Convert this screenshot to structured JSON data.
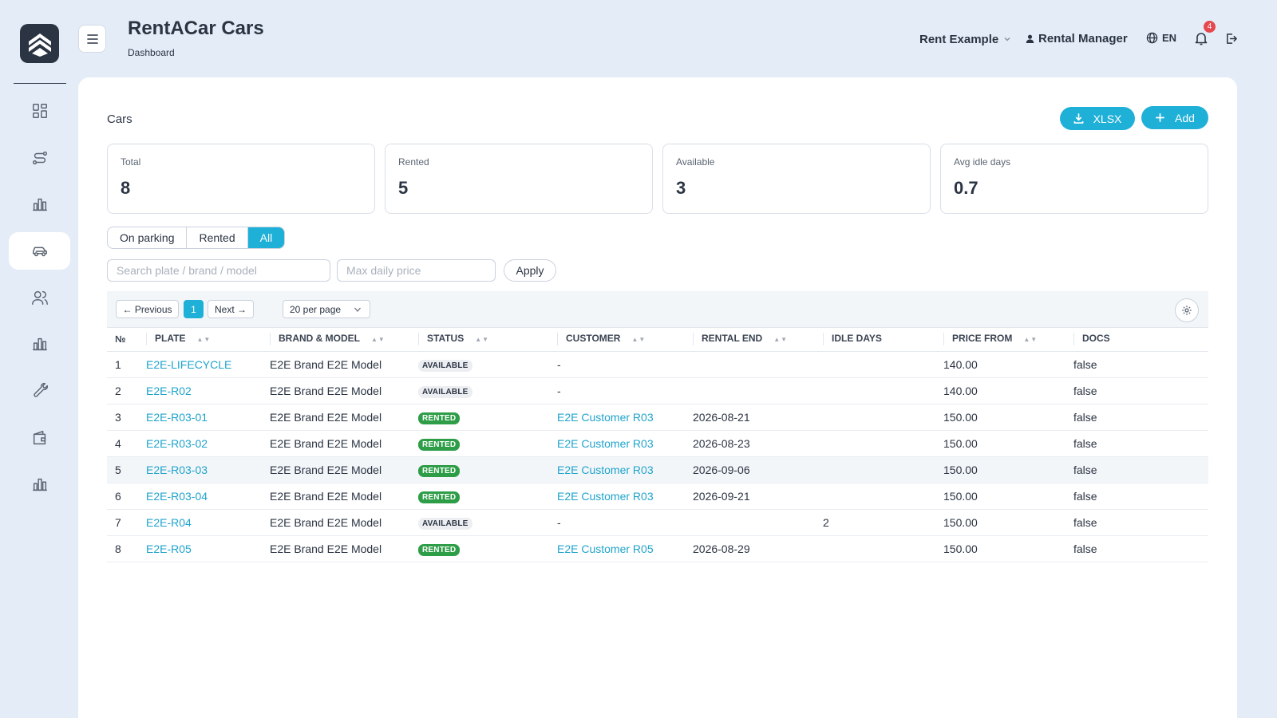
{
  "header": {
    "title": "RentACar Cars",
    "breadcrumb": "Dashboard",
    "tenant": "Rent Example",
    "user": "Rental Manager",
    "language": "EN",
    "notification_count": "4"
  },
  "sidebar": {
    "items": [
      {
        "icon": "dashboard-icon"
      },
      {
        "icon": "routes-icon"
      },
      {
        "icon": "chart-icon"
      },
      {
        "icon": "car-icon",
        "active": true
      },
      {
        "icon": "users-icon"
      },
      {
        "icon": "chart-icon"
      },
      {
        "icon": "wrench-icon"
      },
      {
        "icon": "wallet-icon"
      },
      {
        "icon": "chart-icon"
      }
    ]
  },
  "page": {
    "section_title": "Cars",
    "xlsx_label": "XLSX",
    "add_label": "Add"
  },
  "stats": [
    {
      "label": "Total",
      "value": "8"
    },
    {
      "label": "Rented",
      "value": "5"
    },
    {
      "label": "Available",
      "value": "3"
    },
    {
      "label": "Avg idle days",
      "value": "0.7"
    }
  ],
  "filters": {
    "segments": [
      "On parking",
      "Rented",
      "All"
    ],
    "active_segment": "All",
    "search_placeholder": "Search plate / brand / model",
    "price_placeholder": "Max daily price",
    "apply_label": "Apply"
  },
  "pagination": {
    "previous": "← Previous",
    "current": "1",
    "next": "Next →",
    "per_page": "20 per page"
  },
  "table": {
    "columns": [
      "№",
      "Plate",
      "Brand & Model",
      "Status",
      "Customer",
      "Rental End",
      "Idle Days",
      "Price From",
      "Docs"
    ],
    "rows": [
      {
        "n": "1",
        "plate": "E2E-LIFECYCLE",
        "model": "E2E Brand E2E Model",
        "status": "AVAILABLE",
        "customer": "-",
        "end": "",
        "idle": "",
        "price": "140.00",
        "docs": "false"
      },
      {
        "n": "2",
        "plate": "E2E-R02",
        "model": "E2E Brand E2E Model",
        "status": "AVAILABLE",
        "customer": "-",
        "end": "",
        "idle": "",
        "price": "140.00",
        "docs": "false"
      },
      {
        "n": "3",
        "plate": "E2E-R03-01",
        "model": "E2E Brand E2E Model",
        "status": "RENTED",
        "customer": "E2E Customer R03",
        "end": "2026-08-21",
        "idle": "",
        "price": "150.00",
        "docs": "false"
      },
      {
        "n": "4",
        "plate": "E2E-R03-02",
        "model": "E2E Brand E2E Model",
        "status": "RENTED",
        "customer": "E2E Customer R03",
        "end": "2026-08-23",
        "idle": "",
        "price": "150.00",
        "docs": "false"
      },
      {
        "n": "5",
        "plate": "E2E-R03-03",
        "model": "E2E Brand E2E Model",
        "status": "RENTED",
        "customer": "E2E Customer R03",
        "end": "2026-09-06",
        "idle": "",
        "price": "150.00",
        "docs": "false"
      },
      {
        "n": "6",
        "plate": "E2E-R03-04",
        "model": "E2E Brand E2E Model",
        "status": "RENTED",
        "customer": "E2E Customer R03",
        "end": "2026-09-21",
        "idle": "",
        "price": "150.00",
        "docs": "false"
      },
      {
        "n": "7",
        "plate": "E2E-R04",
        "model": "E2E Brand E2E Model",
        "status": "AVAILABLE",
        "customer": "-",
        "end": "",
        "idle": "2",
        "price": "150.00",
        "docs": "false"
      },
      {
        "n": "8",
        "plate": "E2E-R05",
        "model": "E2E Brand E2E Model",
        "status": "RENTED",
        "customer": "E2E Customer R05",
        "end": "2026-08-29",
        "idle": "",
        "price": "150.00",
        "docs": "false"
      }
    ]
  },
  "colors": {
    "accent": "#1fb0d8",
    "rented_badge": "#2e9d47",
    "notification": "#e5484d"
  }
}
